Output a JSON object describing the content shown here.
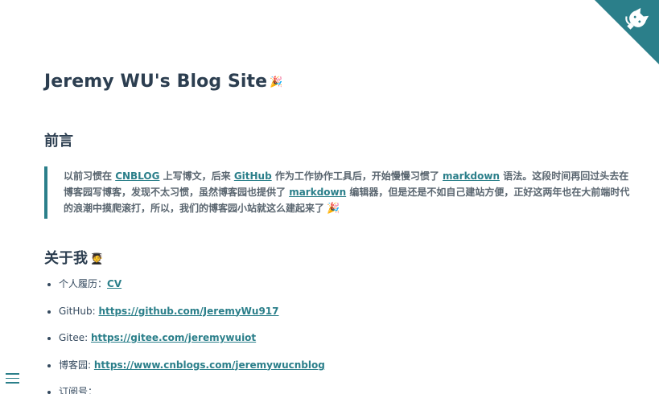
{
  "site": {
    "title": "Jeremy WU's Blog Site",
    "title_emoji": "🎉"
  },
  "corner": {
    "icon": "github-octocat-icon",
    "color": "#2b7f8a"
  },
  "preface": {
    "heading": "前言",
    "text_1": "以前习惯在 ",
    "link_cnblog": "CNBLOG",
    "text_2": " 上写博文，后来 ",
    "link_github": "GitHub",
    "text_3": " 作为工作协作工具后，开始慢慢习惯了 ",
    "link_markdown_1": "markdown",
    "text_4": " 语法。这段时间再回过头去在博客园写博客，发现不太习惯，虽然博客园也提供了 ",
    "link_markdown_2": "markdown",
    "text_5": " 编辑器，但是还是不如自己建站方便，正好这两年也在大前端时代的浪潮中摸爬滚打，所以，我们的博客园小站就这么建起来了",
    "emoji": "🎉"
  },
  "about": {
    "heading": "关于我",
    "emoji": "🧑‍🎓",
    "items": [
      {
        "label": "个人履历：",
        "link": "CV"
      },
      {
        "label": "GitHub: ",
        "link": "https://github.com/JeremyWu917"
      },
      {
        "label": "Gitee: ",
        "link": "https://gitee.com/jeremywuiot"
      },
      {
        "label": "博客园: ",
        "link": "https://www.cnblogs.com/jeremywucnblog"
      },
      {
        "label": "订阅号：",
        "link": ""
      }
    ]
  },
  "colors": {
    "accent": "#2b7f8a",
    "heading": "#2c3e50",
    "text": "#34495e"
  }
}
